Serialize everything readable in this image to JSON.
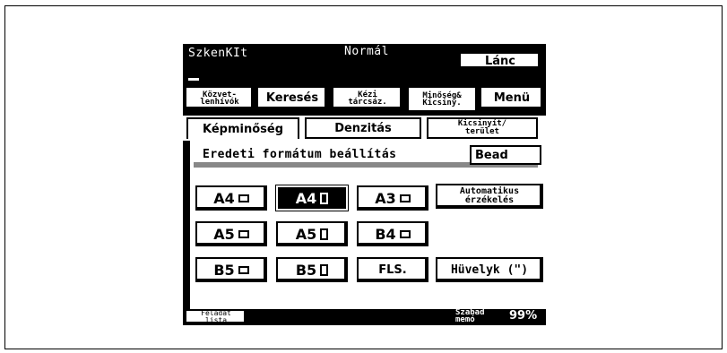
{
  "header": {
    "mode_label": "SzkenKIt",
    "quality_label": "Normál",
    "chain_button": "Lánc"
  },
  "nav_tabs": [
    {
      "label_line1": "Közvet-",
      "label_line2": "lenhívók"
    },
    {
      "label": "Keresés"
    },
    {
      "label_line1": "Kézi",
      "label_line2": "tárcsáz."
    },
    {
      "label_line1": "Minőség&",
      "label_line2": "Kicsiny."
    },
    {
      "label": "Menü"
    }
  ],
  "sub_tabs": [
    {
      "label": "Képminőség"
    },
    {
      "label": "Denzitás"
    },
    {
      "label_line1": "Kicsinyít/",
      "label_line2": "terület"
    }
  ],
  "panel": {
    "title": "Eredeti formátum beállítás",
    "set_button": "Bead"
  },
  "formats": [
    {
      "label": "A4",
      "orientation": "landscape",
      "selected": false
    },
    {
      "label": "A4",
      "orientation": "portrait",
      "selected": true
    },
    {
      "label": "A3",
      "orientation": "landscape",
      "selected": false
    },
    {
      "label": "A5",
      "orientation": "landscape",
      "selected": false
    },
    {
      "label": "A5",
      "orientation": "portrait",
      "selected": false
    },
    {
      "label": "B4",
      "orientation": "landscape",
      "selected": false
    },
    {
      "label": "B5",
      "orientation": "landscape",
      "selected": false
    },
    {
      "label": "B5",
      "orientation": "portrait",
      "selected": false
    },
    {
      "label": "FLS.",
      "orientation": "",
      "selected": false
    }
  ],
  "auto_detect": {
    "label_line1": "Automatikus",
    "label_line2": "érzékelés"
  },
  "inch_button": "Hüvelyk (\")",
  "footer": {
    "job_list_line1": "Feladat",
    "job_list_line2": "lista",
    "memory_line1": "Szabad",
    "memory_line2": "memó",
    "memory_value": "99%"
  }
}
